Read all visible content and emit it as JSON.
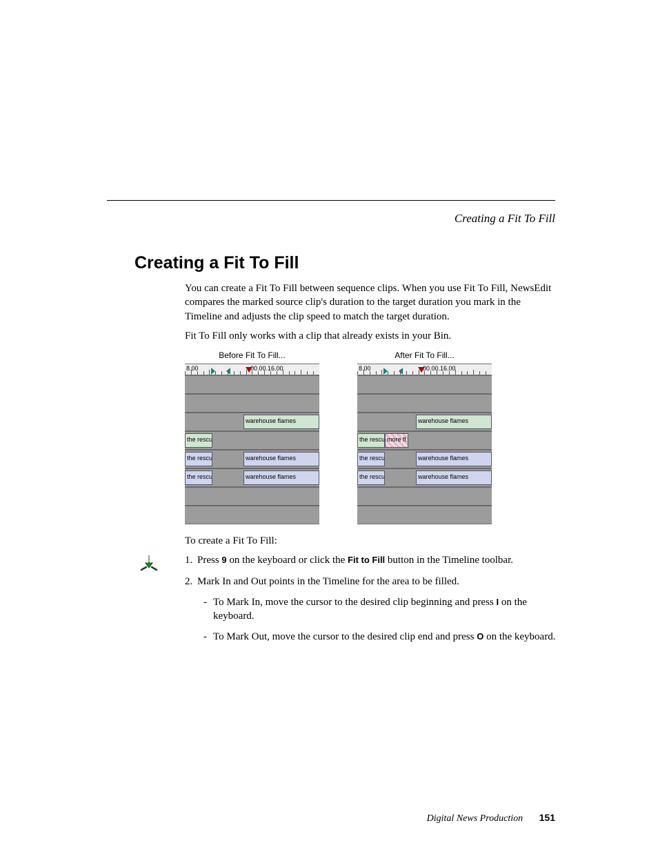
{
  "header": {
    "running": "Creating a Fit To Fill"
  },
  "title": "Creating a Fit To Fill",
  "paragraphs": {
    "p1": "You can create a Fit To Fill between sequence clips. When you use Fit To Fill, NewsEdit compares the marked source clip's duration to the target duration you mark in the Timeline and adjusts the clip speed to match the target duration.",
    "p2": "Fit To Fill only works with a clip that already exists in your Bin.",
    "p3": "To create a Fit To Fill:"
  },
  "figures": {
    "before_caption": "Before Fit To Fill...",
    "after_caption": "After Fit To Fill...",
    "ruler_left": "8.00",
    "ruler_mid": "00.00.16.00",
    "clip_rescue": "the rescue",
    "clip_warehouse": "warehouse flames",
    "clip_more": "more fl..."
  },
  "steps": {
    "s1_a": "Press ",
    "s1_key": "9",
    "s1_b": " on the keyboard or click the ",
    "s1_btn": "Fit to Fill",
    "s1_c": " button in the Timeline toolbar.",
    "s2": "Mark In and Out points in the Timeline for the area to be filled.",
    "s2a_a": "To Mark In, move the cursor to the desired clip beginning and press ",
    "s2a_key": "I",
    "s2a_b": " on the keyboard.",
    "s2b_a": "To Mark Out, move the cursor to the desired clip end and press ",
    "s2b_key": "O",
    "s2b_b": " on the keyboard."
  },
  "footer": {
    "product": "Digital News Production",
    "page": "151"
  }
}
